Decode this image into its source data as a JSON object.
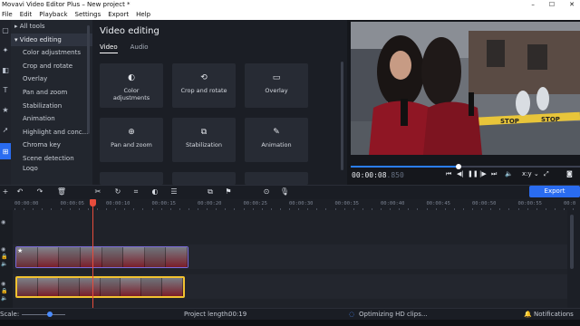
{
  "window": {
    "title": "Movavi Video Editor Plus – New project *",
    "controls": [
      "–",
      "☐",
      "✕"
    ]
  },
  "menu": {
    "items": [
      "File",
      "Edit",
      "Playback",
      "Settings",
      "Export",
      "Help"
    ]
  },
  "left_rail": {
    "icons": [
      "import-icon",
      "filters-icon",
      "transitions-icon",
      "titles-icon",
      "stickers-icon",
      "callouts-icon",
      "more-tools-icon"
    ]
  },
  "tools": {
    "all_tools": "All tools",
    "section": "Video editing",
    "items": [
      "Color adjustments",
      "Crop and rotate",
      "Overlay",
      "Pan and zoom",
      "Stabilization",
      "Animation",
      "Highlight and conc...",
      "Chroma key",
      "Scene detection",
      "Logo"
    ]
  },
  "editing": {
    "title": "Video editing",
    "tabs": [
      "Video",
      "Audio"
    ],
    "cards": [
      {
        "label": "Color adjustments",
        "icon": "color-icon"
      },
      {
        "label": "Crop and rotate",
        "icon": "crop-icon"
      },
      {
        "label": "Overlay",
        "icon": "overlay-icon"
      },
      {
        "label": "Pan and zoom",
        "icon": "zoom-icon"
      },
      {
        "label": "Stabilization",
        "icon": "stabilize-icon"
      },
      {
        "label": "Animation",
        "icon": "animation-icon"
      }
    ]
  },
  "player": {
    "timecode_main": "00:00:08",
    "timecode_ms": ".850",
    "progress": 0.47,
    "aspect": "x:y",
    "caution_tape": "STOP"
  },
  "export": {
    "label": "Export"
  },
  "ruler": {
    "labels": [
      "00:00:00",
      "00:00:05",
      "00:00:10",
      "00:00:15",
      "00:00:20",
      "00:00:25",
      "00:00:30",
      "00:00:35",
      "00:00:40",
      "00:00:45",
      "00:00:50",
      "00:00:55",
      "00:0"
    ]
  },
  "status": {
    "scale_label": "Scale:",
    "project_length_label": "Project length:",
    "project_length": "00:19",
    "optimizing": "Optimizing HD clips...",
    "notifications": "Notifications"
  }
}
